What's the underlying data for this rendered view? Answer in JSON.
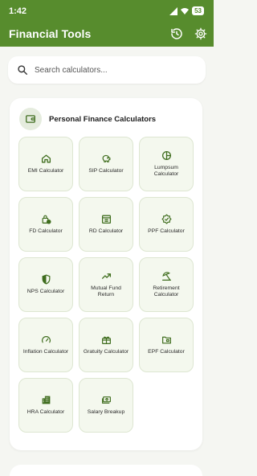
{
  "status_bar": {
    "time": "1:42",
    "battery": "53"
  },
  "app_bar": {
    "title": "Financial Tools"
  },
  "search": {
    "placeholder": "Search calculators..."
  },
  "section": {
    "title": "Personal Finance Calculators"
  },
  "calculators": [
    {
      "label": "EMI Calculator",
      "icon": "home-icon"
    },
    {
      "label": "SIP Calculator",
      "icon": "piggy-bank-icon"
    },
    {
      "label": "Lumpsum Calculator",
      "icon": "pie-chart-icon"
    },
    {
      "label": "FD Calculator",
      "icon": "lock-clock-icon"
    },
    {
      "label": "RD Calculator",
      "icon": "calendar-icon"
    },
    {
      "label": "PPF Calculator",
      "icon": "verified-badge-icon"
    },
    {
      "label": "NPS Calculator",
      "icon": "shield-icon"
    },
    {
      "label": "Mutual Fund Return",
      "icon": "trending-up-icon"
    },
    {
      "label": "Retirement Calculator",
      "icon": "beach-umbrella-icon"
    },
    {
      "label": "Inflation Calculator",
      "icon": "speedometer-icon"
    },
    {
      "label": "Gratuity Calculator",
      "icon": "gift-icon"
    },
    {
      "label": "EPF Calculator",
      "icon": "folder-icon"
    },
    {
      "label": "HRA Calculator",
      "icon": "building-icon"
    },
    {
      "label": "Salary Breakup",
      "icon": "cash-icon"
    }
  ],
  "colors": {
    "primary": "#578c2d",
    "tile_bg": "#f4f8ee",
    "icon": "#3f6d1e"
  }
}
